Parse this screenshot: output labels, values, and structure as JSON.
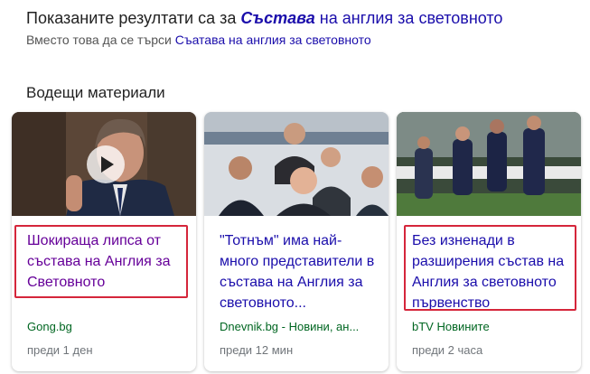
{
  "spelling": {
    "prefix": "Показаните резултати са за",
    "corrected_emphasis": "Състава",
    "corrected_rest": "на англия за световното",
    "instead_prefix": "Вместо това да се търси",
    "instead_link": "Съатава на англия за световното"
  },
  "top_stories": {
    "title": "Водещи материали",
    "cards": [
      {
        "headline": "Шокираща липса от състава на Англия за Световното",
        "source": "Gong.bg",
        "age": "преди 1 ден",
        "has_video": true,
        "play_icon": "play-icon"
      },
      {
        "headline": "\"Тотнъм\" има най-много представители в състава на Англия за световното...",
        "source": "Dnevnik.bg - Новини, ан...",
        "age": "преди 12 мин",
        "has_video": false
      },
      {
        "headline": "Без изненади в разширения състав на Англия за световното първенство",
        "source": "bTV Новините",
        "age": "преди 2 часа",
        "has_video": false
      }
    ]
  },
  "colors": {
    "link": "#1a0dab",
    "visited": "#660099",
    "source_green": "#006621",
    "highlight_red": "#d5263b"
  }
}
